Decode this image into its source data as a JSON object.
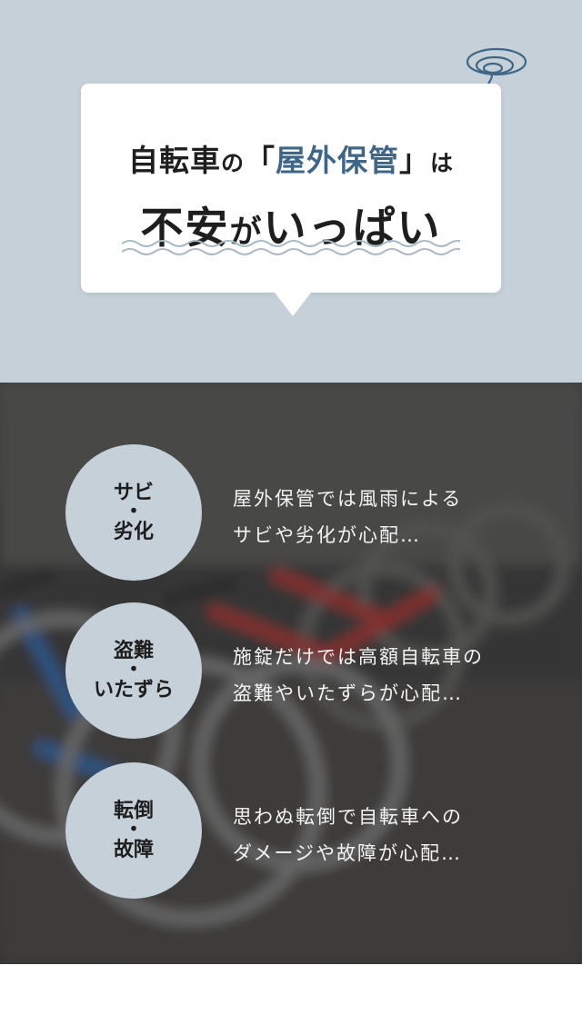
{
  "hero": {
    "line1_part1": "自転車",
    "line1_particle": "の",
    "line1_bracket_open": "「",
    "line1_accent": "屋外保管",
    "line1_bracket_close": "」",
    "line1_particle2": "は",
    "line2_part1": "不安",
    "line2_particle": "が",
    "line2_part2": "いっぱい",
    "colors": {
      "background": "#c5d0d8",
      "accent": "#3f6686",
      "text": "#1e1e1e"
    }
  },
  "issues": [
    {
      "circle_line1": "サビ",
      "circle_dot": "・",
      "circle_line2": "劣化",
      "text_line1": "屋外保管では風雨による",
      "text_line2": "サビや劣化が心配…"
    },
    {
      "circle_line1": "盗難",
      "circle_dot": "・",
      "circle_line2": "いたずら",
      "text_line1": "施錠だけでは高額自転車の",
      "text_line2": "盗難やいたずらが心配…"
    },
    {
      "circle_line1": "転倒",
      "circle_dot": "・",
      "circle_line2": "故障",
      "text_line1": "思わぬ転倒で自転車への",
      "text_line2": "ダメージや故障が心配…"
    }
  ]
}
